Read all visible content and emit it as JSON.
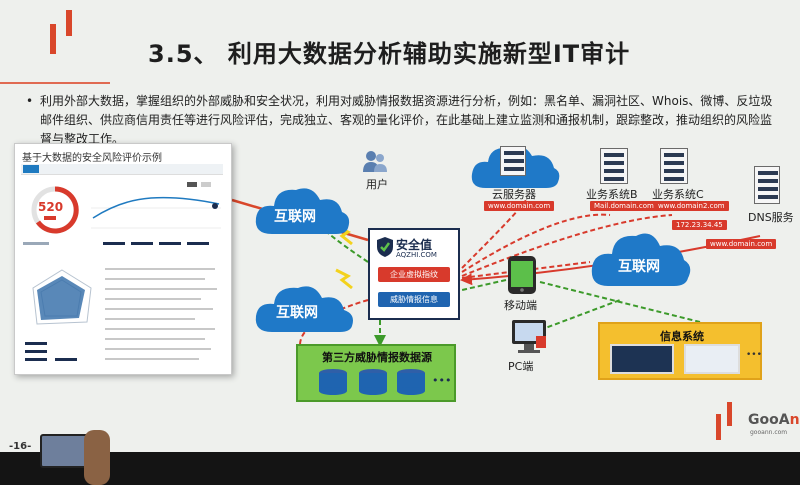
{
  "slide": {
    "title": "3.5、 利用大数据分析辅助实施新型IT审计",
    "bullet": "利用外部大数据，掌握组织的外部威胁和安全状况，利用对威胁情报数据资源进行分析，例如：黑名单、漏洞社区、Whois、微博、反垃圾邮件组织、供应商信用责任等进行风险评估，完成独立、客观的量化评价，在此基础上建立监测和通报机制，跟踪整改，推动组织的风险监督与整改工作。",
    "bullet_symbol": "•",
    "page_number": "-16-"
  },
  "dashboard": {
    "title": "基于大数据的安全风险评价示例",
    "score": "520"
  },
  "diagram": {
    "cloud_left_top": "互联网",
    "cloud_left_bottom": "互联网",
    "cloud_right": "互联网",
    "user_label": "用户",
    "cloud_server_label": "云服务器",
    "cloud_server_url": "www.domain.com",
    "biz_b_label": "业务系统B",
    "biz_b_url": "Mail.domain.com",
    "biz_c_label": "业务系统C",
    "biz_c_url": "www.domain2.com",
    "ip_tag": "172.23.34.45",
    "dns_label": "DNS服务",
    "dns_url": "www.domain.com",
    "brand_name": "安全值",
    "brand_url": "AQZHI.COM",
    "btn_vuln": "企业虚拟指纹",
    "btn_intel": "威胁情报信息",
    "mobile_label": "移动端",
    "pc_label": "PC端",
    "threat_title": "第三方威胁情报数据源",
    "info_title": "信息系统",
    "dots": "•••"
  },
  "logo": {
    "text_a": "GooA",
    "text_b": "n",
    "sub": "gooann.com"
  },
  "colors": {
    "accent_red": "#d9472b",
    "cloud_blue": "#1f79c8",
    "brand_navy": "#1b2d4f",
    "threat_green": "#7cc84c",
    "info_yellow": "#f4bf2e"
  }
}
